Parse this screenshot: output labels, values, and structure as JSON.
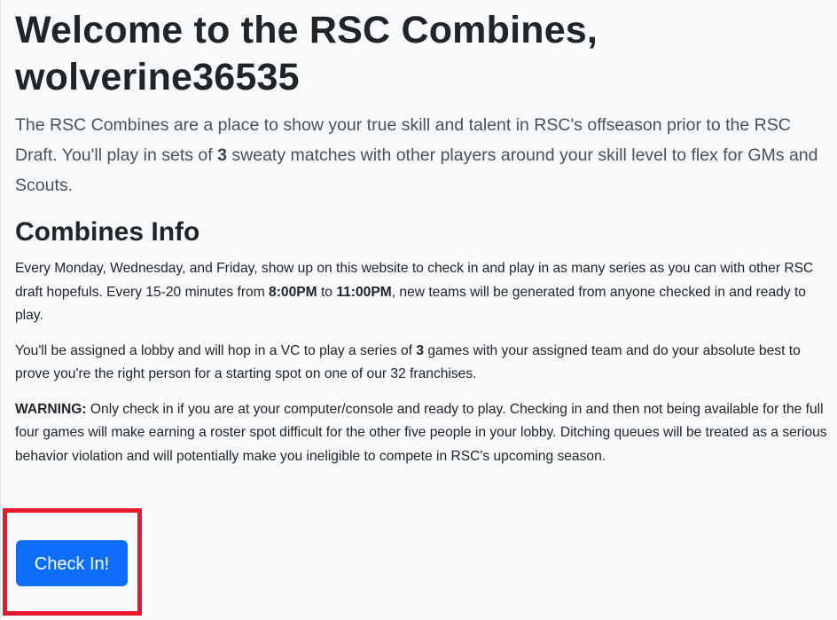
{
  "header": {
    "title_line1": "Welcome to the RSC Combines,",
    "title_line2": "wolverine36535"
  },
  "intro": {
    "part1": "The RSC Combines are a place to show your true skill and talent in RSC's offseason prior to the RSC Draft. You'll play in sets of ",
    "count": "3",
    "part2": " sweaty matches with other players around your skill level to flex for GMs and Scouts."
  },
  "info": {
    "heading": "Combines Info",
    "para1": {
      "part1": "Every Monday, Wednesday, and Friday, show up on this website to check in and play in as many series as you can with other RSC draft hopefuls. Every 15-20 minutes from ",
      "start_time": "8:00PM",
      "middle": " to ",
      "end_time": "11:00PM",
      "part2": ", new teams will be generated from anyone checked in and ready to play."
    },
    "para2": {
      "part1": "You'll be assigned a lobby and will hop in a VC to play a series of ",
      "count": "3",
      "part2": " games with your assigned team and do your absolute best to prove you're the right person for a starting spot on one of our 32 franchises."
    },
    "warning": {
      "label": "WARNING:",
      "text": " Only check in if you are at your computer/console and ready to play. Checking in and then not being available for the full four games will make earning a roster spot difficult for the other five people in your lobby. Ditching queues will be treated as a serious behavior violation and will potentially make you ineligible to compete in RSC's upcoming season."
    }
  },
  "actions": {
    "check_in_label": "Check In!"
  },
  "colors": {
    "primary": "#0d6efd",
    "highlight": "#e8192c",
    "background": "#f8f9fa"
  }
}
